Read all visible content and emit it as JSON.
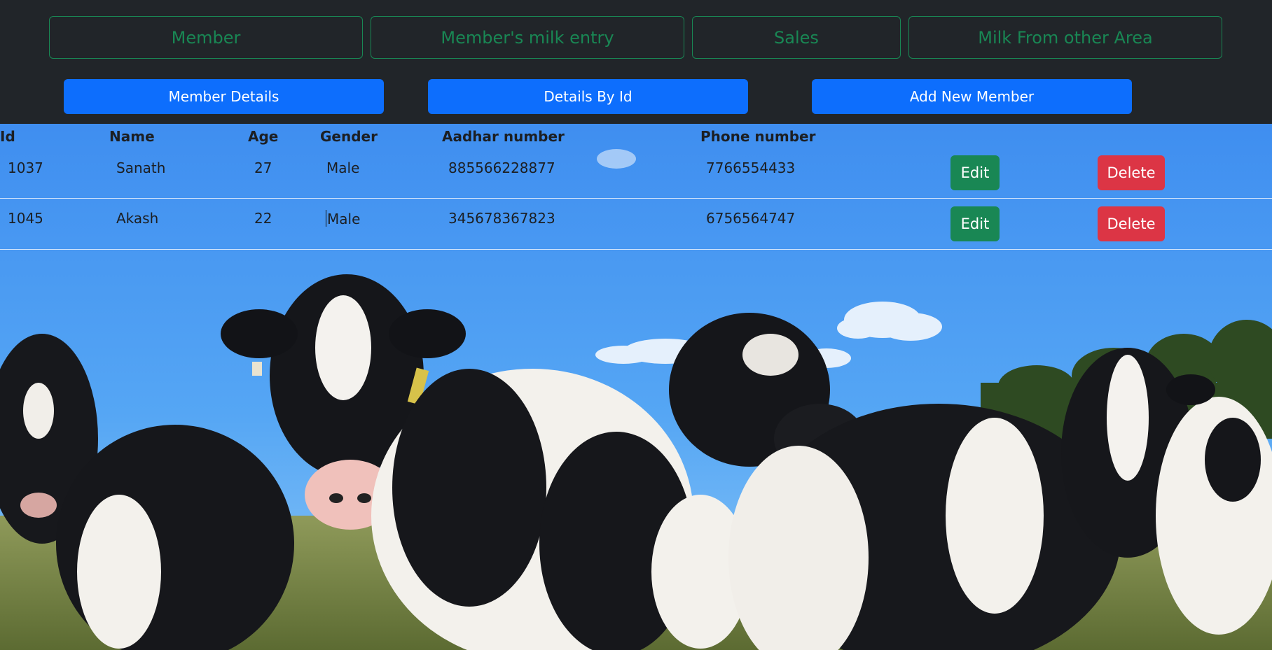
{
  "nav": {
    "items": [
      {
        "label": "Member"
      },
      {
        "label": "Member's milk entry"
      },
      {
        "label": "Sales"
      },
      {
        "label": "Milk From other Area"
      }
    ]
  },
  "subnav": {
    "member_details": "Member Details",
    "details_by_id": "Details By Id",
    "add_new_member": "Add New Member"
  },
  "table": {
    "headers": {
      "id": "Id",
      "name": "Name",
      "age": "Age",
      "gender": "Gender",
      "aadhar": "Aadhar number",
      "phone": "Phone number"
    },
    "rows": [
      {
        "id": "1037",
        "name": "Sanath",
        "age": "27",
        "gender": "Male",
        "aadhar": "885566228877",
        "phone": "7766554433",
        "edit": "Edit",
        "delete": "Delete"
      },
      {
        "id": "1045",
        "name": "Akash",
        "age": "22",
        "gender": "Male",
        "aadhar": "345678367823",
        "phone": "6756564747",
        "edit": "Edit",
        "delete": "Delete"
      }
    ]
  },
  "colors": {
    "nav_outline": "#198754",
    "primary": "#0d6efd",
    "edit": "#198754",
    "delete": "#dc3545",
    "header_bg": "#212529"
  }
}
